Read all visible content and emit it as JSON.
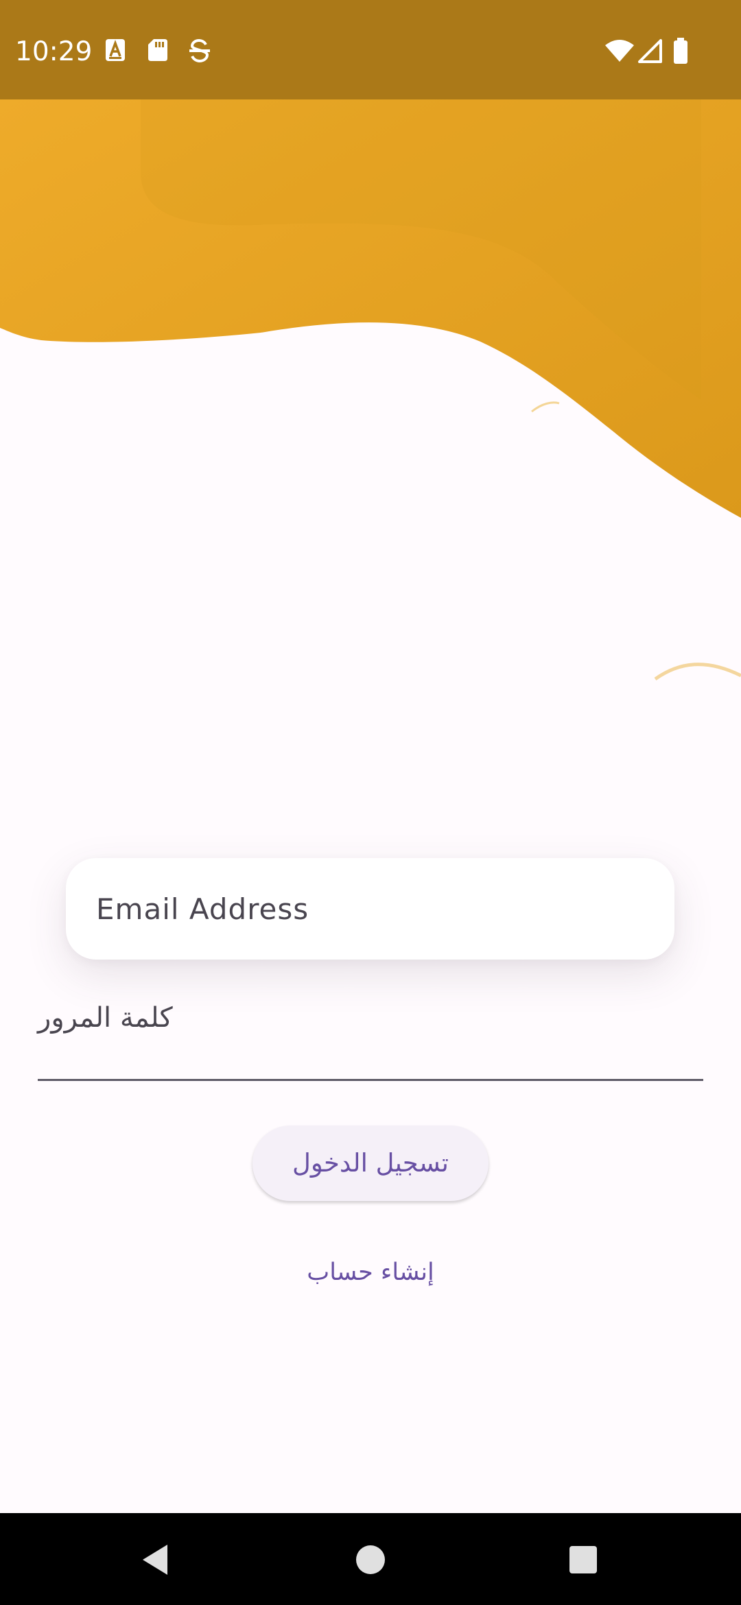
{
  "status_bar": {
    "time": "10:29",
    "notification_icons": [
      "text-a-icon",
      "sd-card-icon",
      "sync-icon"
    ],
    "system_icons": [
      "wifi-icon",
      "cell-signal-icon",
      "battery-icon"
    ],
    "background_color": "#ab7918"
  },
  "login_form": {
    "email": {
      "placeholder": "Email Address",
      "value": ""
    },
    "password": {
      "label": "كلمة المرور",
      "value": ""
    },
    "login_label": "تسجيل الدخول",
    "create_account_label": "إنشاء حساب"
  },
  "navigation_bar": {
    "buttons": [
      "back-icon",
      "home-icon",
      "recents-icon"
    ]
  },
  "colors": {
    "accent_gold": "#e1a020",
    "primary_purple": "#674fa3",
    "background": "#fffbfe"
  }
}
